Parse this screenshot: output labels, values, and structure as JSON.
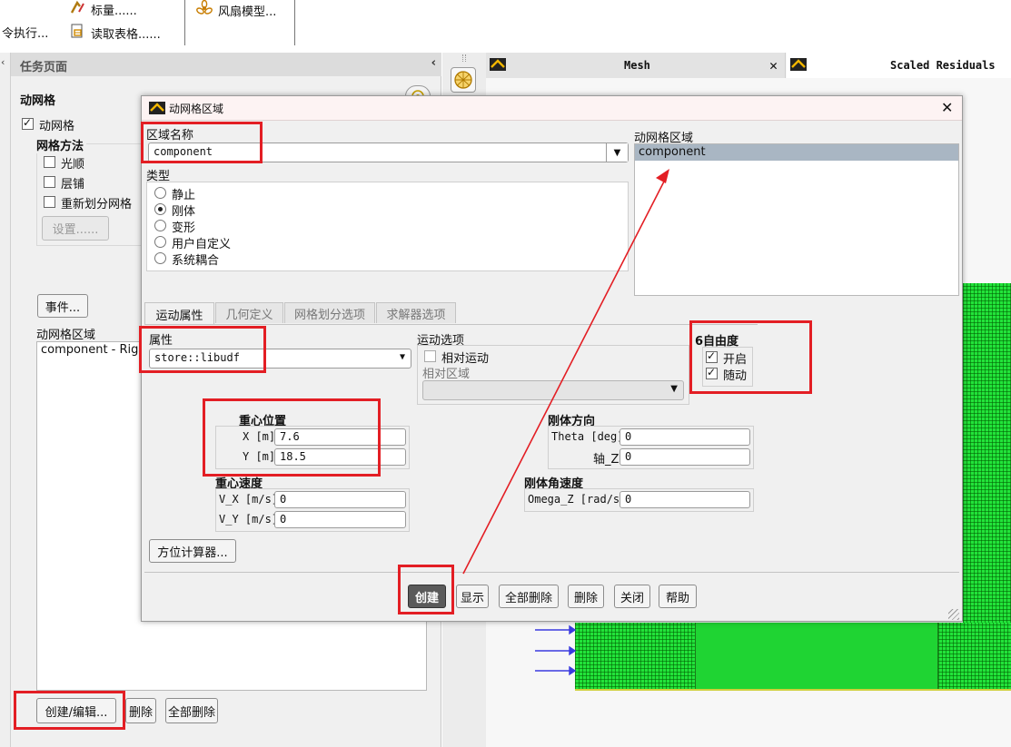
{
  "ribbon": {
    "items": [
      {
        "label": "标量......",
        "icon": "scalar-icon"
      },
      {
        "label": "令执行...",
        "icon": ""
      },
      {
        "label": "读取表格......",
        "icon": "table-icon"
      },
      {
        "label": "风扇模型...",
        "icon": "fan-icon"
      }
    ]
  },
  "task_page": {
    "title": "任务页面",
    "section_title": "动网格",
    "dynamic_mesh_checkbox": "动网格",
    "mesh_methods_label": "网格方法",
    "methods": [
      "光顺",
      "层铺",
      "重新划分网格"
    ],
    "settings_button": "设置......",
    "events_button": "事件...",
    "zones_label": "动网格区域",
    "zones": [
      "component - Rigi"
    ],
    "create_edit_button": "创建/编辑...",
    "delete_button": "删除",
    "delete_all_button": "全部删除"
  },
  "graphics": {
    "tabs": [
      {
        "label": "Mesh",
        "active": false
      },
      {
        "label": "Scaled Residuals",
        "active": true
      }
    ],
    "mesh_color": "#22e33a"
  },
  "dialog": {
    "title": "动网格区域",
    "zone_name_label": "区域名称",
    "zone_name_value": "component",
    "type_label": "类型",
    "types": [
      {
        "label": "静止",
        "selected": false
      },
      {
        "label": "刚体",
        "selected": true
      },
      {
        "label": "变形",
        "selected": false
      },
      {
        "label": "用户自定义",
        "selected": false
      },
      {
        "label": "系统耦合",
        "selected": false
      }
    ],
    "dynamic_zones_label": "动网格区域",
    "dynamic_zones": [
      "component"
    ],
    "tabs": [
      "运动属性",
      "几何定义",
      "网格划分选项",
      "求解器选项"
    ],
    "active_tab": 0,
    "property_label": "属性",
    "property_value": "store::libudf",
    "motion_options_label": "运动选项",
    "relative_motion_label": "相对运动",
    "relative_zone_label": "相对区域",
    "dof_label": "6自由度",
    "dof_on_label": "开启",
    "dof_passive_label": "随动",
    "cg_location_label": "重心位置",
    "x_label": "X [m]",
    "x_value": "7.6",
    "y_label": "Y [m]",
    "y_value": "18.5",
    "cg_velocity_label": "重心速度",
    "vx_label": "V_X [m/s]",
    "vx_value": "0",
    "vy_label": "V_Y [m/s]",
    "vy_value": "0",
    "orientation_label": "刚体方向",
    "theta_label": "Theta [deg]",
    "theta_value": "0",
    "axis_label": "轴_Z",
    "axis_value": "0",
    "angular_velocity_label": "刚体角速度",
    "omega_label": "Omega_Z [rad/s]",
    "omega_value": "0",
    "orientation_calc_button": "方位计算器...",
    "buttons": {
      "create": "创建",
      "display": "显示",
      "delete_all": "全部删除",
      "delete": "删除",
      "close": "关闭",
      "help": "帮助"
    }
  },
  "colors": {
    "highlight": "#e31e24",
    "selection": "#a9b6c3"
  }
}
